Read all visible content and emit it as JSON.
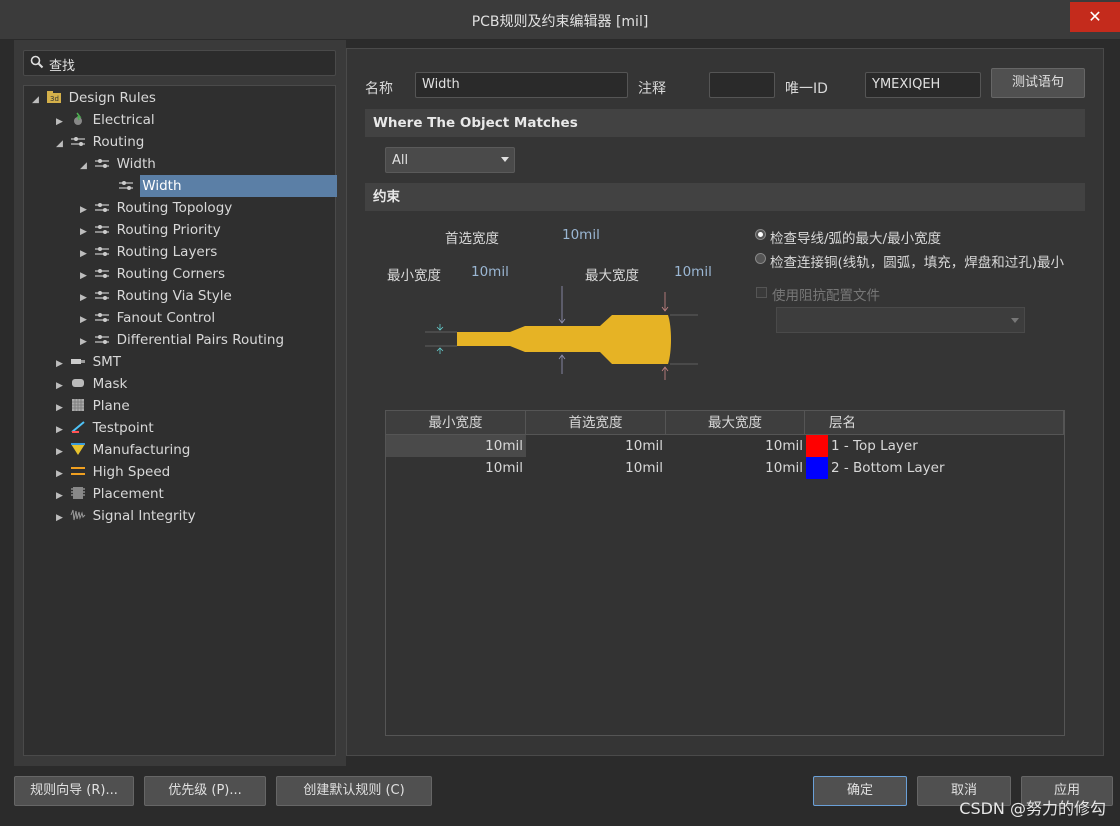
{
  "window": {
    "title": "PCB规则及约束编辑器 [mil]",
    "close_glyph": "✕"
  },
  "search": {
    "placeholder": "查找",
    "icon": "search-icon"
  },
  "tree": {
    "root": "Design Rules",
    "items": [
      {
        "label": "Electrical",
        "icon": "electrical-icon"
      },
      {
        "label": "Routing",
        "icon": "routing-icon"
      },
      {
        "label": "Width",
        "icon": "rule-icon"
      },
      {
        "label": "Width",
        "icon": "rule-icon"
      },
      {
        "label": "Routing Topology",
        "icon": "rule-icon"
      },
      {
        "label": "Routing Priority",
        "icon": "rule-icon"
      },
      {
        "label": "Routing Layers",
        "icon": "rule-icon"
      },
      {
        "label": "Routing Corners",
        "icon": "rule-icon"
      },
      {
        "label": "Routing Via Style",
        "icon": "rule-icon"
      },
      {
        "label": "Fanout Control",
        "icon": "rule-icon"
      },
      {
        "label": "Differential Pairs Routing",
        "icon": "rule-icon"
      },
      {
        "label": "SMT",
        "icon": "smt-icon"
      },
      {
        "label": "Mask",
        "icon": "mask-icon"
      },
      {
        "label": "Plane",
        "icon": "plane-icon"
      },
      {
        "label": "Testpoint",
        "icon": "testpoint-icon"
      },
      {
        "label": "Manufacturing",
        "icon": "manufacturing-icon"
      },
      {
        "label": "High Speed",
        "icon": "high-speed-icon"
      },
      {
        "label": "Placement",
        "icon": "placement-icon"
      },
      {
        "label": "Signal Integrity",
        "icon": "signal-integrity-icon"
      }
    ]
  },
  "rule": {
    "name_label": "名称",
    "name_value": "Width",
    "comment_label": "注释",
    "comment_value": "",
    "uid_label": "唯一ID",
    "uid_value": "YMEXIQEH",
    "test_button": "测试语句"
  },
  "where": {
    "header": "Where The Object Matches",
    "scope_value": "All"
  },
  "constraints": {
    "header": "约束",
    "preferred_label": "首选宽度",
    "preferred_value": "10mil",
    "min_label": "最小宽度",
    "min_value": "10mil",
    "max_label": "最大宽度",
    "max_value": "10mil",
    "radio1": "检查导线/弧的最大/最小宽度",
    "radio2": "检查连接铜(线轨，圆弧，填充，焊盘和过孔)最小",
    "impedance_label": "使用阻抗配置文件",
    "trace_color": "#e6b325"
  },
  "layer_table": {
    "columns": [
      "最小宽度",
      "首选宽度",
      "最大宽度",
      "层名"
    ],
    "rows": [
      {
        "min": "10mil",
        "pref": "10mil",
        "max": "10mil",
        "layer": "1 - Top Layer",
        "color": "#ff0000"
      },
      {
        "min": "10mil",
        "pref": "10mil",
        "max": "10mil",
        "layer": "2 - Bottom Layer",
        "color": "#0000ff"
      }
    ]
  },
  "footer": {
    "wizard": "规则向导 (R)...",
    "priority": "优先级 (P)...",
    "create_default": "创建默认规则 (C)",
    "ok": "确定",
    "cancel": "取消",
    "apply": "应用"
  },
  "watermark": "CSDN @努力的修勾"
}
